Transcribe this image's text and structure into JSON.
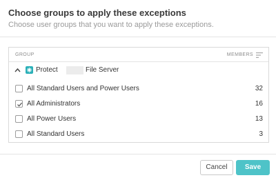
{
  "dialog": {
    "title": "Choose groups to apply these exceptions",
    "subtitle": "Choose user groups that you want to apply these exceptions."
  },
  "table": {
    "columns": {
      "group": "GROUP",
      "members": "MEMBERS"
    },
    "sort_icon": "sort-lines-icon",
    "node": {
      "label_prefix": "Protect",
      "label_suffix": "File Server",
      "expanded": true,
      "icon": "server-node-icon"
    },
    "rows": [
      {
        "label": "All Standard Users and Power Users",
        "members": "32",
        "checked": false
      },
      {
        "label": "All Administrators",
        "members": "16",
        "checked": true
      },
      {
        "label": "All Power Users",
        "members": "13",
        "checked": false
      },
      {
        "label": "All Standard Users",
        "members": "3",
        "checked": false
      }
    ]
  },
  "footer": {
    "cancel_label": "Cancel",
    "save_label": "Save"
  },
  "colors": {
    "accent": "#4ec3c8",
    "node_icon": "#2bb0b8",
    "border": "#d9d9d9"
  }
}
